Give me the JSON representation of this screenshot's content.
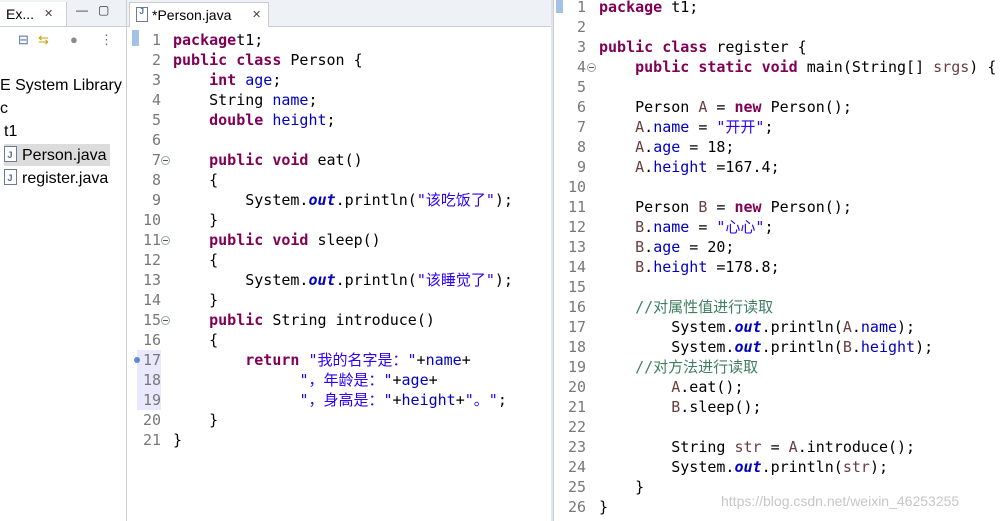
{
  "explorer": {
    "tab_title": "Ex...",
    "tree": [
      {
        "label": "E System Library"
      },
      {
        "label": "c"
      },
      {
        "label": "t1"
      },
      {
        "label": "Person.java"
      },
      {
        "label": "register.java"
      }
    ]
  },
  "editor_left": {
    "tab_title": "*Person.java",
    "lines": [
      {
        "n": "1",
        "t": [
          [
            "kw",
            "package"
          ],
          [
            "",
            "t1;"
          ]
        ]
      },
      {
        "n": "2",
        "t": [
          [
            "kw",
            "public"
          ],
          [
            "",
            " "
          ],
          [
            "kw",
            "class"
          ],
          [
            "",
            " Person {"
          ]
        ]
      },
      {
        "n": "3",
        "t": [
          [
            "",
            "    "
          ],
          [
            "kw",
            "int"
          ],
          [
            "",
            " "
          ],
          [
            "fld",
            "age"
          ],
          [
            "",
            ";"
          ]
        ]
      },
      {
        "n": "4",
        "t": [
          [
            "",
            "    String "
          ],
          [
            "fld",
            "name"
          ],
          [
            "",
            ";"
          ]
        ]
      },
      {
        "n": "5",
        "t": [
          [
            "",
            "    "
          ],
          [
            "kw",
            "double"
          ],
          [
            "",
            " "
          ],
          [
            "fld",
            "height"
          ],
          [
            "",
            ";"
          ]
        ]
      },
      {
        "n": "6",
        "t": []
      },
      {
        "n": "7",
        "t": [
          [
            "",
            "    "
          ],
          [
            "kw",
            "public"
          ],
          [
            "",
            " "
          ],
          [
            "kw",
            "void"
          ],
          [
            "",
            " eat()"
          ]
        ],
        "fold": true
      },
      {
        "n": "8",
        "t": [
          [
            "",
            "    {"
          ]
        ]
      },
      {
        "n": "9",
        "t": [
          [
            "",
            "        System."
          ],
          [
            "stat",
            "out"
          ],
          [
            "",
            ".println("
          ],
          [
            "str",
            "\"该吃饭了\""
          ],
          [
            "",
            ");"
          ]
        ]
      },
      {
        "n": "10",
        "t": [
          [
            "",
            "    }"
          ]
        ]
      },
      {
        "n": "11",
        "t": [
          [
            "",
            "    "
          ],
          [
            "kw",
            "public"
          ],
          [
            "",
            " "
          ],
          [
            "kw",
            "void"
          ],
          [
            "",
            " sleep()"
          ]
        ],
        "fold": true
      },
      {
        "n": "12",
        "t": [
          [
            "",
            "    {"
          ]
        ]
      },
      {
        "n": "13",
        "t": [
          [
            "",
            "        System."
          ],
          [
            "stat",
            "out"
          ],
          [
            "",
            ".println("
          ],
          [
            "str",
            "\"该睡觉了\""
          ],
          [
            "",
            ");"
          ]
        ]
      },
      {
        "n": "14",
        "t": [
          [
            "",
            "    }"
          ]
        ]
      },
      {
        "n": "15",
        "t": [
          [
            "",
            "    "
          ],
          [
            "kw",
            "public"
          ],
          [
            "",
            " String introduce()"
          ]
        ],
        "fold": true
      },
      {
        "n": "16",
        "t": [
          [
            "",
            "    {"
          ]
        ]
      },
      {
        "n": "17",
        "t": [
          [
            "",
            "        "
          ],
          [
            "kw",
            "return"
          ],
          [
            "",
            " "
          ],
          [
            "str",
            "\"我的名字是：\""
          ],
          [
            "",
            "+"
          ],
          [
            "fld",
            "name"
          ],
          [
            "",
            "+"
          ]
        ],
        "hl": true,
        "marker": true
      },
      {
        "n": "18",
        "t": [
          [
            "",
            "              "
          ],
          [
            "str",
            "\"，年龄是：\""
          ],
          [
            "",
            "+"
          ],
          [
            "fld",
            "age"
          ],
          [
            "",
            "+"
          ]
        ],
        "hl": true
      },
      {
        "n": "19",
        "t": [
          [
            "",
            "              "
          ],
          [
            "str",
            "\"，身高是：\""
          ],
          [
            "",
            "+"
          ],
          [
            "fld",
            "height"
          ],
          [
            "",
            "+"
          ],
          [
            "str",
            "\"。\""
          ],
          [
            "",
            ";"
          ]
        ],
        "hl": true
      },
      {
        "n": "20",
        "t": [
          [
            "",
            "    }"
          ]
        ]
      },
      {
        "n": "21",
        "t": [
          [
            "",
            "}"
          ]
        ]
      }
    ]
  },
  "editor_right": {
    "lines": [
      {
        "n": "1",
        "t": [
          [
            "kw",
            "package"
          ],
          [
            "",
            " t1;"
          ]
        ]
      },
      {
        "n": "2",
        "t": []
      },
      {
        "n": "3",
        "t": [
          [
            "kw",
            "public"
          ],
          [
            "",
            " "
          ],
          [
            "kw",
            "class"
          ],
          [
            "",
            " register {"
          ]
        ]
      },
      {
        "n": "4",
        "t": [
          [
            "",
            "    "
          ],
          [
            "kw",
            "public"
          ],
          [
            "",
            " "
          ],
          [
            "kw",
            "static"
          ],
          [
            "",
            " "
          ],
          [
            "kw",
            "void"
          ],
          [
            "",
            " main(String[] "
          ],
          [
            "var",
            "srgs"
          ],
          [
            "",
            ") {"
          ]
        ],
        "fold": true
      },
      {
        "n": "5",
        "t": []
      },
      {
        "n": "6",
        "t": [
          [
            "",
            "    Person "
          ],
          [
            "var",
            "A"
          ],
          [
            "",
            " = "
          ],
          [
            "kw",
            "new"
          ],
          [
            "",
            " Person();"
          ]
        ]
      },
      {
        "n": "7",
        "t": [
          [
            "",
            "    "
          ],
          [
            "var",
            "A"
          ],
          [
            "",
            "."
          ],
          [
            "fld",
            "name"
          ],
          [
            "",
            " = "
          ],
          [
            "str",
            "\"开开\""
          ],
          [
            "",
            ";"
          ]
        ]
      },
      {
        "n": "8",
        "t": [
          [
            "",
            "    "
          ],
          [
            "var",
            "A"
          ],
          [
            "",
            "."
          ],
          [
            "fld",
            "age"
          ],
          [
            "",
            " = 18;"
          ]
        ]
      },
      {
        "n": "9",
        "t": [
          [
            "",
            "    "
          ],
          [
            "var",
            "A"
          ],
          [
            "",
            "."
          ],
          [
            "fld",
            "height"
          ],
          [
            "",
            " =167.4;"
          ]
        ]
      },
      {
        "n": "10",
        "t": []
      },
      {
        "n": "11",
        "t": [
          [
            "",
            "    Person "
          ],
          [
            "var",
            "B"
          ],
          [
            "",
            " = "
          ],
          [
            "kw",
            "new"
          ],
          [
            "",
            " Person();"
          ]
        ]
      },
      {
        "n": "12",
        "t": [
          [
            "",
            "    "
          ],
          [
            "var",
            "B"
          ],
          [
            "",
            "."
          ],
          [
            "fld",
            "name"
          ],
          [
            "",
            " = "
          ],
          [
            "str",
            "\"心心\""
          ],
          [
            "",
            ";"
          ]
        ]
      },
      {
        "n": "13",
        "t": [
          [
            "",
            "    "
          ],
          [
            "var",
            "B"
          ],
          [
            "",
            "."
          ],
          [
            "fld",
            "age"
          ],
          [
            "",
            " = 20;"
          ]
        ]
      },
      {
        "n": "14",
        "t": [
          [
            "",
            "    "
          ],
          [
            "var",
            "B"
          ],
          [
            "",
            "."
          ],
          [
            "fld",
            "height"
          ],
          [
            "",
            " =178.8;"
          ]
        ]
      },
      {
        "n": "15",
        "t": []
      },
      {
        "n": "16",
        "t": [
          [
            "",
            "    "
          ],
          [
            "cmt",
            "//对属性值进行读取"
          ]
        ]
      },
      {
        "n": "17",
        "t": [
          [
            "",
            "        System."
          ],
          [
            "stat",
            "out"
          ],
          [
            "",
            ".println("
          ],
          [
            "var",
            "A"
          ],
          [
            "",
            "."
          ],
          [
            "fld",
            "name"
          ],
          [
            "",
            ");"
          ]
        ]
      },
      {
        "n": "18",
        "t": [
          [
            "",
            "        System."
          ],
          [
            "stat",
            "out"
          ],
          [
            "",
            ".println("
          ],
          [
            "var",
            "B"
          ],
          [
            "",
            "."
          ],
          [
            "fld",
            "height"
          ],
          [
            "",
            ");"
          ]
        ]
      },
      {
        "n": "19",
        "t": [
          [
            "",
            "    "
          ],
          [
            "cmt",
            "//对方法进行读取"
          ]
        ]
      },
      {
        "n": "20",
        "t": [
          [
            "",
            "        "
          ],
          [
            "var",
            "A"
          ],
          [
            "",
            ".eat();"
          ]
        ]
      },
      {
        "n": "21",
        "t": [
          [
            "",
            "        "
          ],
          [
            "var",
            "B"
          ],
          [
            "",
            ".sleep();"
          ]
        ]
      },
      {
        "n": "22",
        "t": []
      },
      {
        "n": "23",
        "t": [
          [
            "",
            "        String "
          ],
          [
            "var",
            "str"
          ],
          [
            "",
            " = "
          ],
          [
            "var",
            "A"
          ],
          [
            "",
            ".introduce();"
          ]
        ]
      },
      {
        "n": "24",
        "t": [
          [
            "",
            "        System."
          ],
          [
            "stat",
            "out"
          ],
          [
            "",
            ".println("
          ],
          [
            "var",
            "str"
          ],
          [
            "",
            ");"
          ]
        ]
      },
      {
        "n": "25",
        "t": [
          [
            "",
            "    }"
          ]
        ]
      },
      {
        "n": "26",
        "t": [
          [
            "",
            "}"
          ]
        ]
      }
    ]
  },
  "watermark": "https://blog.csdn.net/weixin_46253255"
}
